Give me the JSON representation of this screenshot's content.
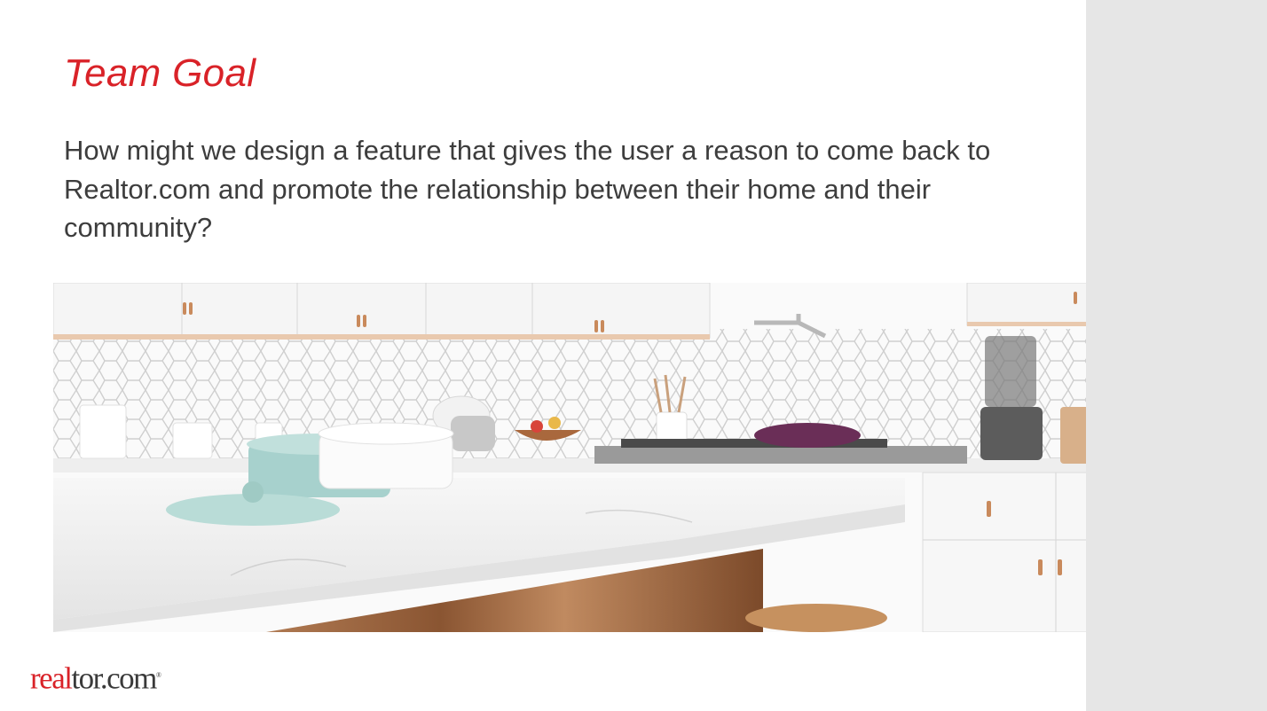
{
  "slide": {
    "title": "Team Goal",
    "body": "How might we design a feature that gives the user a reason to come back to Realtor.com and promote the relationship between their home and their community?",
    "photo_subject": "kitchen-photo",
    "logo": {
      "part_red": "real",
      "part_dark": "tor.com",
      "mark": "®"
    }
  },
  "colors": {
    "title_red": "#d92228",
    "body_text": "#3d3d3d",
    "side_panel": "#e6e6e6",
    "background": "#ffffff"
  }
}
